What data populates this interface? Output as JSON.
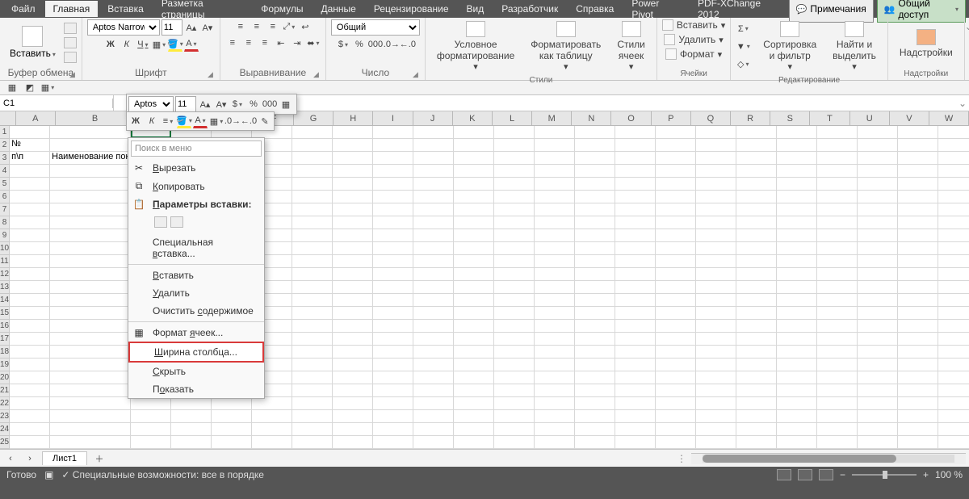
{
  "tabs": [
    "Файл",
    "Главная",
    "Вставка",
    "Разметка страницы",
    "Формулы",
    "Данные",
    "Рецензирование",
    "Вид",
    "Разработчик",
    "Справка",
    "Power Pivot",
    "PDF-XChange 2012"
  ],
  "active_tab": 1,
  "right": {
    "notes": "Примечания",
    "share": "Общий доступ"
  },
  "ribbon": {
    "clipboard": {
      "paste": "Вставить",
      "label": "Буфер обмена"
    },
    "font": {
      "name": "Aptos Narrow",
      "size": "11",
      "b": "Ж",
      "i": "К",
      "u": "Ч",
      "label": "Шрифт"
    },
    "align": {
      "label": "Выравнивание"
    },
    "number": {
      "format": "Общий",
      "label": "Число"
    },
    "styles": {
      "cond": "Условное форматирование",
      "table": "Форматировать как таблицу",
      "cell": "Стили ячеек",
      "label": "Стили"
    },
    "cells": {
      "ins": "Вставить",
      "del": "Удалить",
      "fmt": "Формат",
      "label": "Ячейки"
    },
    "edit": {
      "sort": "Сортировка и фильтр",
      "find": "Найти и выделить",
      "label": "Редактирование"
    },
    "addins": {
      "btn": "Надстройки",
      "label": "Надстройки"
    }
  },
  "mini": {
    "font": "Aptos Na",
    "size": "11"
  },
  "namebox": "C1",
  "columns": [
    "A",
    "B",
    "C",
    "D",
    "E",
    "F",
    "G",
    "H",
    "I",
    "J",
    "K",
    "L",
    "M",
    "N",
    "O",
    "P",
    "Q",
    "R",
    "S",
    "T",
    "U",
    "V",
    "W"
  ],
  "rows": 25,
  "cell_data": {
    "A2": "№",
    "A3": "п\\п",
    "B3": "Наименование показателя"
  },
  "context": {
    "search": "Поиск в меню",
    "items": [
      {
        "id": "cut",
        "label": "Вырезать",
        "u": 0,
        "icon": "✂"
      },
      {
        "id": "copy",
        "label": "Копировать",
        "u": 0,
        "icon": "⧉"
      },
      {
        "id": "paste-opt",
        "label": "Параметры вставки:",
        "u": 0,
        "bold": true,
        "icon": "📋"
      },
      {
        "id": "paste-icons",
        "icons": true
      },
      {
        "id": "paste-special",
        "label": "Специальная вставка...",
        "u": 12
      },
      {
        "sep": true
      },
      {
        "id": "insert",
        "label": "Вставить",
        "u": 0
      },
      {
        "id": "delete",
        "label": "Удалить",
        "u": 0
      },
      {
        "id": "clear",
        "label": "Очистить содержимое",
        "u": 9
      },
      {
        "sep": true
      },
      {
        "id": "format-cells",
        "label": "Формат ячеек...",
        "u": 7,
        "icon": "▦"
      },
      {
        "id": "col-width",
        "label": "Ширина столбца...",
        "u": 0,
        "highlight": true
      },
      {
        "id": "hide",
        "label": "Скрыть",
        "u": 0
      },
      {
        "id": "show",
        "label": "Показать",
        "u": 1
      }
    ]
  },
  "sheet": "Лист1",
  "status": {
    "ready": "Готово",
    "access": "Специальные возможности: все в порядке",
    "zoom": "100 %"
  }
}
